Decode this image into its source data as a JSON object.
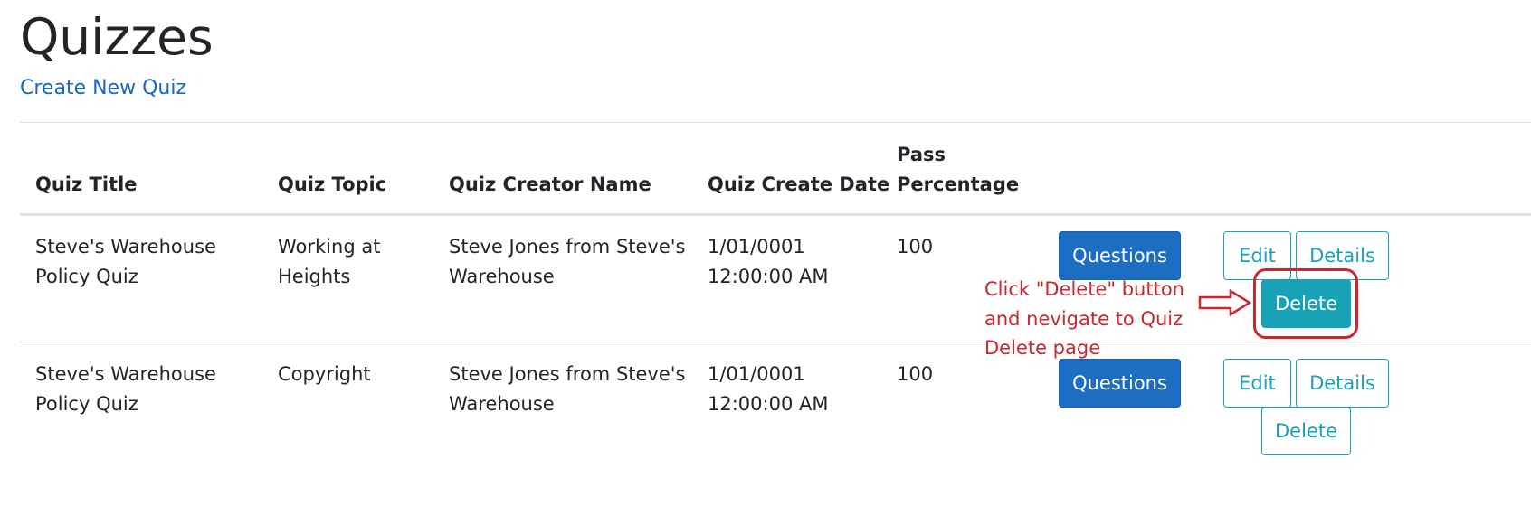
{
  "page": {
    "title": "Quizzes",
    "create_link": "Create New Quiz"
  },
  "table": {
    "headers": {
      "title": "Quiz Title",
      "topic": "Quiz Topic",
      "creator": "Quiz Creator Name",
      "date": "Quiz Create Date",
      "pass_line1": "Pass",
      "pass_line2": "Percentage"
    },
    "rows": [
      {
        "title_l1": "Steve's Warehouse",
        "title_l2": "Policy Quiz",
        "topic_l1": "Working at",
        "topic_l2": "Heights",
        "creator_l1": "Steve Jones from Steve's",
        "creator_l2": "Warehouse",
        "date_l1": "1/01/0001",
        "date_l2": "12:00:00 AM",
        "pass": "100",
        "questions_label": "Questions",
        "edit_label": "Edit",
        "details_label": "Details",
        "delete_label": "Delete"
      },
      {
        "title_l1": "Steve's Warehouse",
        "title_l2": "Policy Quiz",
        "topic_l1": "Copyright",
        "topic_l2": "",
        "creator_l1": "Steve Jones from Steve's",
        "creator_l2": "Warehouse",
        "date_l1": "1/01/0001",
        "date_l2": "12:00:00 AM",
        "pass": "100",
        "questions_label": "Questions",
        "edit_label": "Edit",
        "details_label": "Details",
        "delete_label": "Delete"
      }
    ]
  },
  "annotation": {
    "line1": "Click \"Delete\" button",
    "line2": "and nevigate to Quiz",
    "line3": "Delete page"
  },
  "colors": {
    "link": "#1a68c1",
    "primary_button": "#1b6ec2",
    "info_button": "#17a2b8",
    "annotation_red": "#c8282f"
  }
}
